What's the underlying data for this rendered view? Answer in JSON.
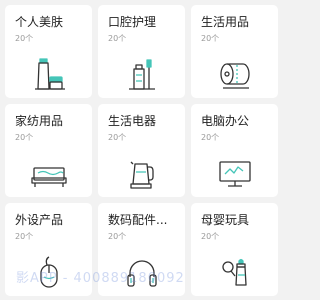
{
  "categories": [
    {
      "name": "个人美肤",
      "count": "20个",
      "icon": "skincare-icon"
    },
    {
      "name": "口腔护理",
      "count": "20个",
      "icon": "toothbrush-icon"
    },
    {
      "name": "生活用品",
      "count": "20个",
      "icon": "tissue-roll-icon"
    },
    {
      "name": "家纺用品",
      "count": "20个",
      "icon": "bed-icon"
    },
    {
      "name": "生活电器",
      "count": "20个",
      "icon": "kettle-icon"
    },
    {
      "name": "电脑办公",
      "count": "20个",
      "icon": "monitor-icon"
    },
    {
      "name": "外设产品",
      "count": "20个",
      "icon": "mouse-icon"
    },
    {
      "name": "数码配件...",
      "count": "20个",
      "icon": "headphones-icon"
    },
    {
      "name": "母婴玩具",
      "count": "20个",
      "icon": "baby-bottle-icon"
    }
  ],
  "watermark": "影APP - 400889180092",
  "colors": {
    "accent": "#45c5b8",
    "line": "#333333"
  }
}
